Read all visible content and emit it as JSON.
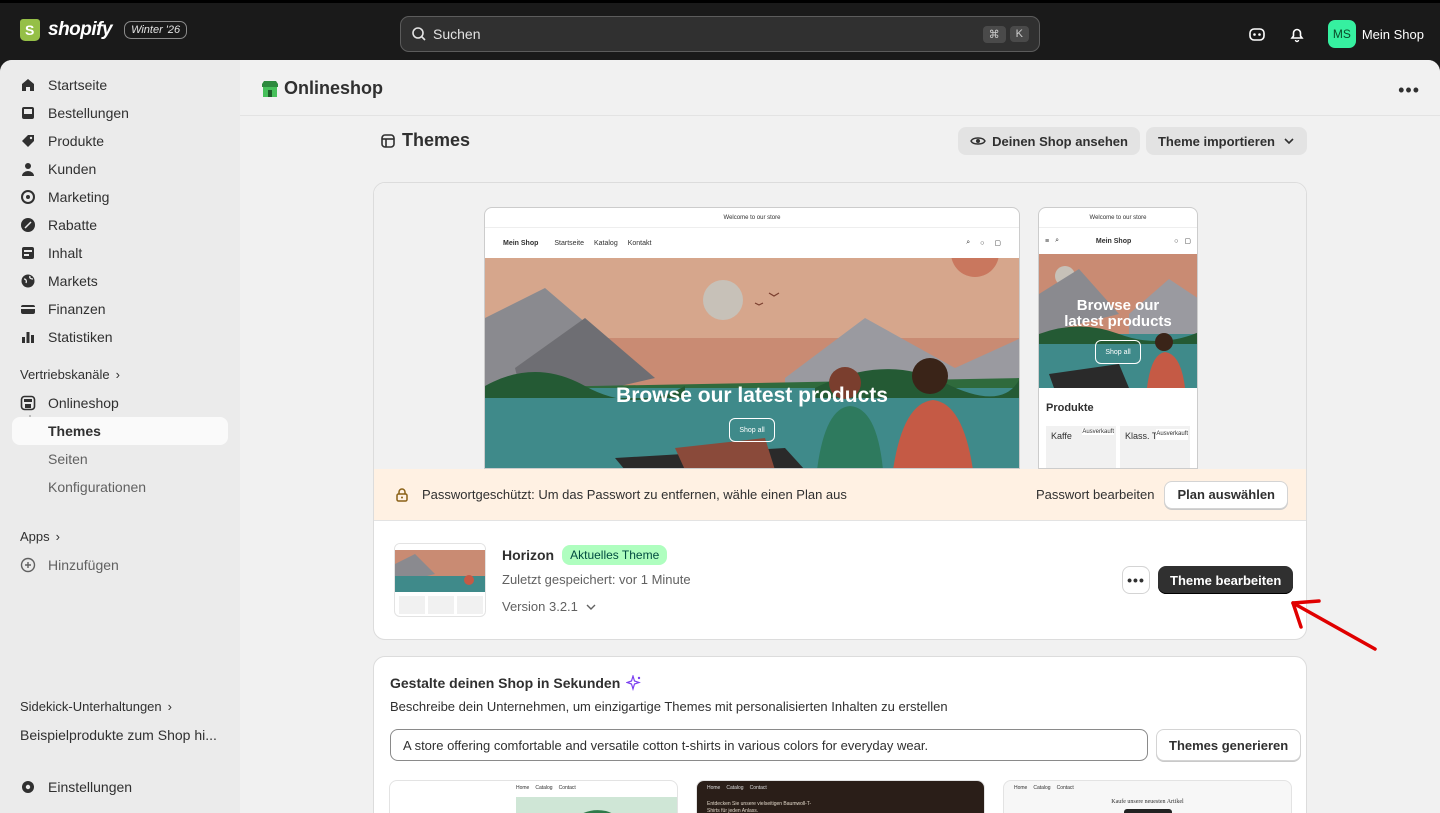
{
  "topbar": {
    "logo": "shopify",
    "edition": "Winter '26",
    "search_placeholder": "Suchen",
    "kbd_cmd": "⌘",
    "kbd_k": "K",
    "avatar_initials": "MS",
    "store_name": "Mein Shop"
  },
  "sidebar": {
    "items": [
      {
        "label": "Startseite",
        "icon": "home-icon"
      },
      {
        "label": "Bestellungen",
        "icon": "inbox-icon"
      },
      {
        "label": "Produkte",
        "icon": "tag-icon"
      },
      {
        "label": "Kunden",
        "icon": "person-icon"
      },
      {
        "label": "Marketing",
        "icon": "target-icon"
      },
      {
        "label": "Rabatte",
        "icon": "discount-icon"
      },
      {
        "label": "Inhalt",
        "icon": "content-icon"
      },
      {
        "label": "Markets",
        "icon": "globe-icon"
      },
      {
        "label": "Finanzen",
        "icon": "bank-icon"
      },
      {
        "label": "Statistiken",
        "icon": "chart-icon"
      }
    ],
    "sales_channels_label": "Vertriebskanäle",
    "online_store": "Onlineshop",
    "sub_items": [
      "Themes",
      "Seiten",
      "Konfigurationen"
    ],
    "apps_label": "Apps",
    "add_label": "Hinzufügen",
    "sidekick_label": "Sidekick-Unterhaltungen",
    "sidekick_item": "Beispielprodukte zum Shop hi...",
    "settings_label": "Einstellungen"
  },
  "page": {
    "title": "Onlineshop",
    "themes_title": "Themes",
    "view_shop": "Deinen Shop ansehen",
    "import_theme": "Theme importieren"
  },
  "preview": {
    "announcement": "Welcome to our store",
    "shop_name": "Mein Shop",
    "nav": [
      "Startseite",
      "Katalog",
      "Kontakt"
    ],
    "hero_title": "Browse our latest products",
    "hero_title_mobile_1": "Browse our",
    "hero_title_mobile_2": "latest products",
    "hero_button": "Shop all",
    "products_heading": "Produkte",
    "product_1": "Kaffe",
    "product_2": "Klass. T-Shirt",
    "sold_out": "Ausverkauft"
  },
  "banner": {
    "message": "Passwortgeschützt: Um das Passwort zu entfernen, wähle einen Plan aus",
    "edit_password": "Passwort bearbeiten",
    "choose_plan": "Plan auswählen"
  },
  "theme": {
    "name": "Horizon",
    "badge": "Aktuelles Theme",
    "last_saved": "Zuletzt gespeichert: vor 1 Minute",
    "version": "Version 3.2.1",
    "edit_button": "Theme bearbeiten",
    "thumb_caption": "Browse our latest products"
  },
  "generator": {
    "title": "Gestalte deinen Shop in Sekunden",
    "subtitle": "Beschreibe dein Unternehmen, um einzigartige Themes mit personalisierten Inhalten zu erstellen",
    "input_value": "A store offering comfortable and versatile cotton t-shirts in various colors for everyday wear.",
    "button": "Themes generieren",
    "mini_nav": [
      "Home",
      "Catalog",
      "Contact"
    ],
    "mini_text_2": "Entdecken Sie unsere vielseitigen Baumwoll-T-Shirts für jeden Anlass.",
    "mini_text_3": "Kaufe unsere neuesten Artikel"
  },
  "colors": {
    "accent_green": "#36f0a0",
    "badge_bg": "#affebf",
    "banner_bg": "#fff1e3",
    "annotation_red": "#e00000"
  }
}
